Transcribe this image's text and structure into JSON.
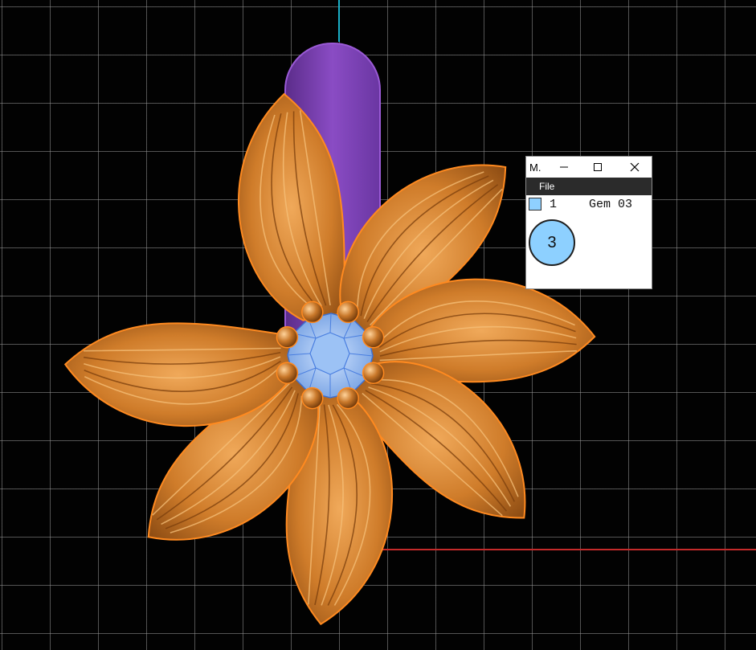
{
  "viewport": {
    "background": "#020202",
    "grid_color": "#969696",
    "axis_y_color": "#1ab0c8",
    "axis_x_color": "#c42a2a"
  },
  "model": {
    "petal_color": "#d2812e",
    "petal_outline": "#ff8a20",
    "bail_color": "#7a3fb0",
    "gem_color": "#8fbff5",
    "prong_count": 8,
    "petal_count": 7
  },
  "mini_window": {
    "title": "M.",
    "minimize_glyph": "–",
    "maximize_glyph": "☐",
    "close_glyph": "✕",
    "menu_file": "File",
    "gem_row": {
      "swatch_color": "#8fd0ff",
      "index": "1",
      "name": "Gem 03"
    },
    "count_badge": "3"
  }
}
